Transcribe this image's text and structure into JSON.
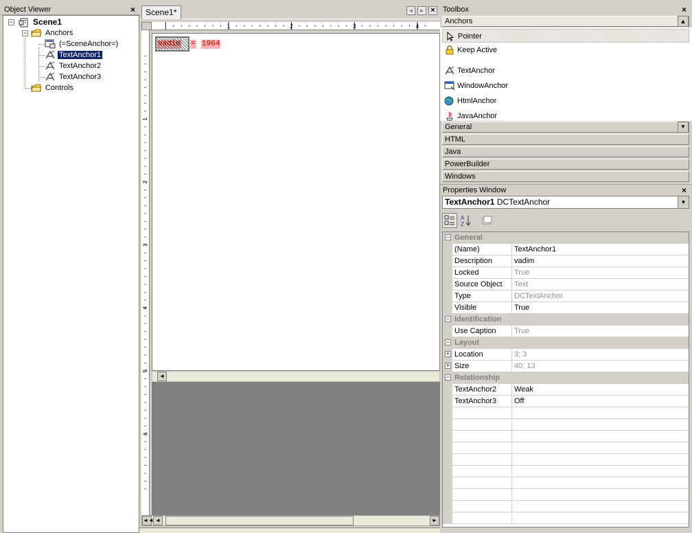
{
  "object_viewer": {
    "title": "Object Viewer",
    "close": "×",
    "tree": {
      "root": "Scene1",
      "anchors": "Anchors",
      "scene_anchor": "(=SceneAnchor=)",
      "text_anchor_1": "TextAnchor1",
      "text_anchor_2": "TextAnchor2",
      "text_anchor_3": "TextAnchor3",
      "controls": "Controls",
      "expand_minus": "−"
    }
  },
  "designer": {
    "tab_label": "Scene1*",
    "close": "×",
    "ruler_top": [
      "1",
      "2",
      "3",
      "4"
    ],
    "ruler_left": [
      "1",
      "2",
      "3",
      "4",
      "5",
      "6"
    ],
    "canvas": {
      "anchor_text_1": "vadim",
      "anchor_text_2": "=",
      "anchor_text_3": "1964"
    },
    "scroll_left": "◄",
    "scroll_right": "►",
    "scroll_first": "◄◄"
  },
  "toolbox": {
    "title": "Toolbox",
    "close": "×",
    "category_anchors": "Anchors",
    "items": {
      "pointer": "Pointer",
      "keep_active": "Keep Active",
      "text_anchor": "TextAnchor",
      "window_anchor": "WindowAnchor",
      "html_anchor": "HtmlAnchor",
      "java_anchor": "JavaAnchor"
    },
    "categories": {
      "general": "General",
      "html": "HTML",
      "java": "Java",
      "powerbuilder": "PowerBuilder",
      "windows": "Windows"
    },
    "dropdown_arrow": "▼"
  },
  "properties": {
    "title": "Properties Window",
    "close": "×",
    "object_name": "TextAnchor1",
    "object_type": "DCTextAnchor",
    "combo_arrow": "▼",
    "categories": {
      "general": "General",
      "identification": "Identification",
      "layout": "Layout",
      "relationship": "Relationship"
    },
    "rows": {
      "name_label": "(Name)",
      "name_value": "TextAnchor1",
      "description_label": "Description",
      "description_value": "vadim",
      "locked_label": "Locked",
      "locked_value": "True",
      "source_object_label": "Source Object",
      "source_object_value": "Text",
      "type_label": "Type",
      "type_value": "DCTextAnchor",
      "visible_label": "Visible",
      "visible_value": "True",
      "use_caption_label": "Use Caption",
      "use_caption_value": "True",
      "location_label": "Location",
      "location_value": "3; 3",
      "size_label": "Size",
      "size_value": "40; 13",
      "rel_anchor2_label": "TextAnchor2",
      "rel_anchor2_value": "Weak",
      "rel_anchor3_label": "TextAnchor3",
      "rel_anchor3_value": "Off"
    },
    "expand_minus": "−",
    "expand_plus": "+"
  },
  "colors": {
    "selection": "#0a246a",
    "anchor_highlight": "#ffb0b0",
    "anchor_text": "#c00000",
    "chrome": "#d4d0c8"
  }
}
